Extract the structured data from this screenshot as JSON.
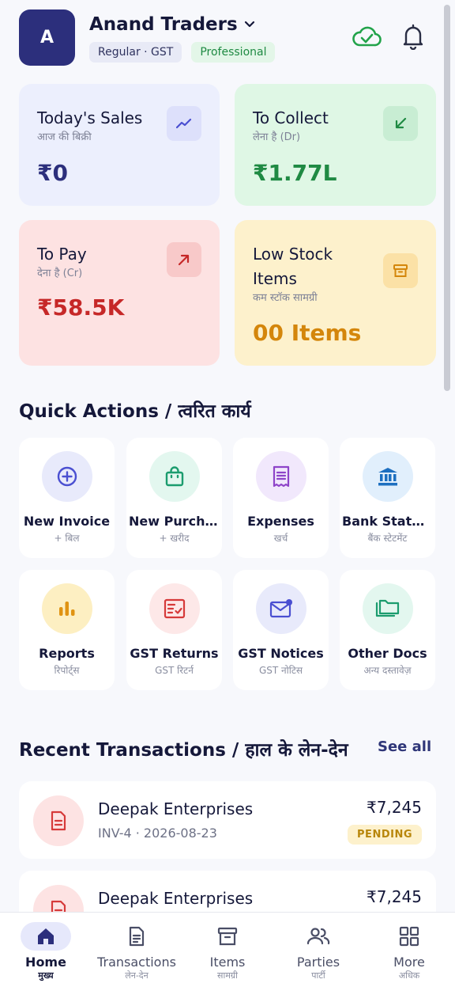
{
  "header": {
    "avatar_letter": "A",
    "business_name": "Anand Traders",
    "badge_plan": "Regular · GST",
    "badge_tier": "Professional"
  },
  "stats": {
    "sales": {
      "title": "Today's Sales",
      "sub": "आज की बिक्री",
      "value": "₹0",
      "color": "#2c2f7c"
    },
    "collect": {
      "title": "To Collect",
      "sub": "लेना है (Dr)",
      "value": "₹1.77L",
      "color": "#1f8a43"
    },
    "pay": {
      "title": "To Pay",
      "sub": "देना है (Cr)",
      "value": "₹58.5K",
      "color": "#c62828"
    },
    "stock": {
      "title": "Low Stock Items",
      "sub": "कम स्टॉक सामग्री",
      "value": "00 Items",
      "color": "#d4860b"
    }
  },
  "quick_actions": {
    "title": "Quick Actions / त्वरित कार्य",
    "items": [
      {
        "label": "New Invoice",
        "sub": "+ बिल",
        "icon": "plus-circle-icon"
      },
      {
        "label": "New Purchase",
        "sub": "+ खरीद",
        "icon": "shopping-bag-icon"
      },
      {
        "label": "Expenses",
        "sub": "खर्च",
        "icon": "receipt-icon"
      },
      {
        "label": "Bank Statement",
        "sub": "बैंक स्टेटमेंट",
        "icon": "bank-icon"
      },
      {
        "label": "Reports",
        "sub": "रिपोर्ट्स",
        "icon": "bar-chart-icon"
      },
      {
        "label": "GST Returns",
        "sub": "GST रिटर्न",
        "icon": "checklist-icon"
      },
      {
        "label": "GST Notices",
        "sub": "GST नोटिस",
        "icon": "mail-notification-icon"
      },
      {
        "label": "Other Docs",
        "sub": "अन्य दस्तावेज़",
        "icon": "folders-icon"
      }
    ]
  },
  "transactions": {
    "title": "Recent Transactions / हाल के लेन-देन",
    "see_all": "See all",
    "items": [
      {
        "name": "Deepak Enterprises",
        "meta": "INV-4 · 2026-08-23",
        "amount": "₹7,245",
        "status": "PENDING"
      },
      {
        "name": "Deepak Enterprises",
        "meta": "",
        "amount": "₹7,245",
        "status": ""
      }
    ]
  },
  "bottom_nav": [
    {
      "label": "Home",
      "sub": "मुख्य",
      "active": true
    },
    {
      "label": "Transactions",
      "sub": "लेन-देन"
    },
    {
      "label": "Items",
      "sub": "सामग्री"
    },
    {
      "label": "Parties",
      "sub": "पार्टी"
    },
    {
      "label": "More",
      "sub": "अधिक"
    }
  ]
}
